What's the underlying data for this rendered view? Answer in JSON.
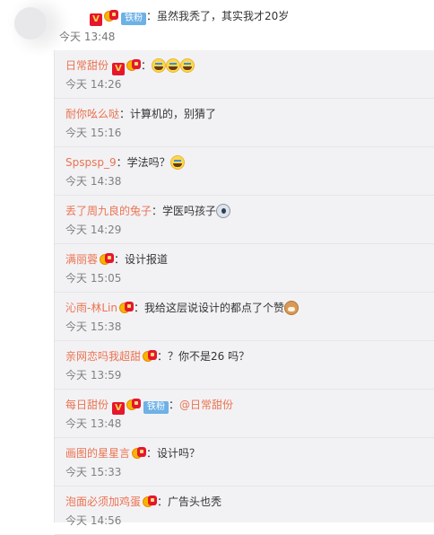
{
  "top_comment": {
    "separator": "：",
    "fan_badge": "铁粉",
    "text": "虽然我秃了，其实我才20岁",
    "time": "今天 13:48"
  },
  "replies": [
    {
      "user": "日常甜份",
      "badges": [
        "v",
        "vip"
      ],
      "fan": "",
      "sep": "：",
      "mention": "",
      "text": "",
      "emoji": [
        "laugh",
        "laugh",
        "laugh"
      ],
      "time": "今天 14:26"
    },
    {
      "user": "耐你吆么哒",
      "badges": [],
      "fan": "",
      "sep": "：",
      "mention": "",
      "text": "计算机的，别猜了",
      "emoji": [],
      "time": "今天 15:16"
    },
    {
      "user": "Spspsp_9",
      "badges": [],
      "fan": "",
      "sep": "：",
      "mention": "",
      "text": "学法吗？",
      "emoji": [
        "laugh"
      ],
      "time": "今天 14:38"
    },
    {
      "user": "丢了周九良的兔子",
      "badges": [],
      "fan": "",
      "sep": "：",
      "mention": "",
      "text": "学医吗孩子",
      "emoji": [
        "stare"
      ],
      "time": "今天 14:29"
    },
    {
      "user": "满丽蓉",
      "badges": [
        "vip"
      ],
      "fan": "",
      "sep": "：",
      "mention": "",
      "text": "设计报道",
      "emoji": [],
      "time": "今天 15:05"
    },
    {
      "user": "沁雨-林Lin",
      "badges": [
        "vip"
      ],
      "fan": "",
      "sep": "：",
      "mention": "",
      "text": "我给这层说设计的都点了个赞",
      "emoji": [
        "dog"
      ],
      "time": "今天 15:38"
    },
    {
      "user": "亲网恋吗我超甜",
      "badges": [
        "vip"
      ],
      "fan": "",
      "sep": "：",
      "mention": "",
      "text": "？你不是26 吗？",
      "emoji": [],
      "time": "今天 13:59"
    },
    {
      "user": "每日甜份",
      "badges": [
        "v",
        "vip"
      ],
      "fan": "铁粉",
      "sep": "：",
      "mention": "@日常甜份",
      "text": "",
      "emoji": [],
      "time": "今天 13:48"
    },
    {
      "user": "画图的星星言",
      "badges": [
        "vip"
      ],
      "fan": "",
      "sep": "：",
      "mention": "",
      "text": "设计吗？",
      "emoji": [],
      "time": "今天 15:33"
    },
    {
      "user": "泡面必须加鸡蛋",
      "badges": [
        "vip"
      ],
      "fan": "",
      "sep": "：",
      "mention": "",
      "text": "广告头也秃",
      "emoji": [],
      "time": "今天 14:56"
    }
  ],
  "colors": {
    "username": "#eb7350",
    "reply_bg": "#f2f2f5",
    "time": "#808080",
    "fan_badge": "#6db1e6",
    "v_badge": "#e6162d"
  }
}
